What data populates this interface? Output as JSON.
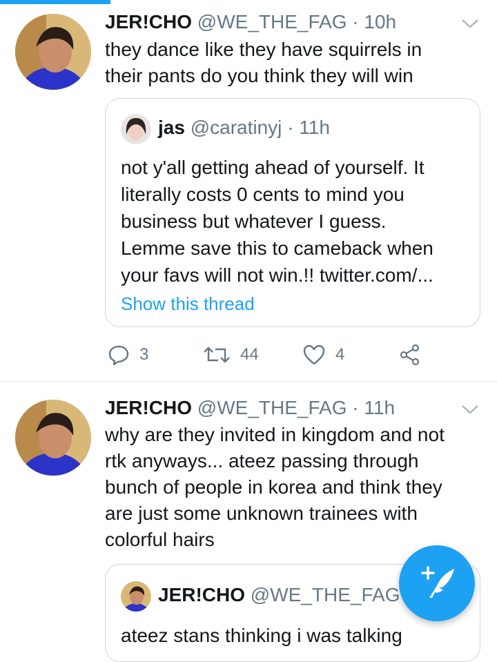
{
  "tweets": [
    {
      "name": "JER!CHO",
      "handle": "@WE_THE_FAG",
      "separator": "·",
      "time": "10h",
      "text_lines": [
        "they dance like they have squirrels in",
        "their pants do you think they will win"
      ],
      "quote": {
        "name": "jas",
        "handle": "@caratinyj",
        "separator": "·",
        "time": "11h",
        "text_lines": [
          "not y'all getting ahead of yourself. It",
          "literally costs 0 cents to mind you",
          "business but whatever I guess.",
          "Lemme save this to cameback when",
          "your favs will not win.!! twitter.com/..."
        ],
        "show_thread": "Show this thread"
      },
      "actions": {
        "replies": "3",
        "retweets": "44",
        "likes": "4"
      }
    },
    {
      "name": "JER!CHO",
      "handle": "@WE_THE_FAG",
      "separator": "·",
      "time": "11h",
      "text_lines": [
        "why are they invited in kingdom and not",
        "rtk anyways... ateez passing through",
        "bunch of people in korea and think they",
        "are just some unknown trainees with",
        "colorful hairs"
      ],
      "quote": {
        "name": "JER!CHO",
        "handle": "@WE_THE_FAG",
        "text_lines": [
          "ateez stans thinking i was talking"
        ]
      }
    }
  ],
  "colors": {
    "accent": "#1da1f2",
    "secondary": "#657786",
    "text": "#14171a"
  },
  "icons": {
    "reply": "reply-icon",
    "retweet": "retweet-icon",
    "like": "heart-icon",
    "share": "share-icon",
    "compose": "compose-tweet-icon",
    "caret": "chevron-down-icon"
  }
}
